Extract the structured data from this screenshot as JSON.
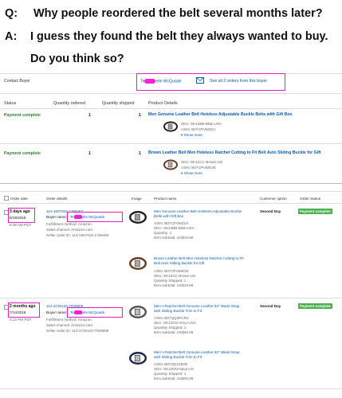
{
  "qa": {
    "q_label": "Q:",
    "q_text": "Why people reordered the belt several months later?",
    "a_label": "A:",
    "a_line1": "I guess they found the belt they always wanted to buy.",
    "a_line2": "Do you think so?"
  },
  "contact": {
    "label": "Contact Buyer",
    "buyer_prefix": "Te",
    "buyer_suffix": "elle McQuade",
    "all_orders_link": "See all 2 orders from this buyer"
  },
  "summary": {
    "headers": [
      "Status",
      "Quantity ordered",
      "Quantity shipped",
      "Product Details"
    ],
    "rows": [
      {
        "status": "Payment complete",
        "qty_ordered": "1",
        "qty_shipped": "1",
        "title": "Men Genuine Leather Belt Holeless Adjustable Buckle Belts with Gift Box",
        "sku": "SKU: SK12BB-Blak-USA",
        "asin": "ASIN: B07CPVMZ1H",
        "more": "Show more"
      },
      {
        "status": "Payment complete",
        "qty_ordered": "1",
        "qty_shipped": "1",
        "title": "Brown Leather Belt Men Holeless Ratchet Cutting to Fit Belt Auto Sliding Buckle for Gift",
        "sku": "SKU: SK12CC-Brown-US",
        "asin": "ASIN: B07CPV58CM",
        "more": "Show more"
      }
    ]
  },
  "orders": {
    "headers": [
      "Order date",
      "Order details",
      "Image",
      "Product name",
      "Customer option",
      "Order Status"
    ],
    "list": [
      {
        "ago": "3 days ago",
        "date": "9/19/2018",
        "time": "9:39 AM PDT",
        "order_id": "114-1607915-1759463",
        "buyer_label": "Buyer name:",
        "buyer_prefix": "Te",
        "buyer_suffix": "elle McQuade",
        "fulfillment": "Fulfillment method: Amazon",
        "channel": "Sales channel: Amazon.com",
        "seller_order": "Seller order ID: 114-1607915-1759463",
        "customer_option": "Second Day",
        "status": "Payment complete",
        "items": [
          {
            "name": "Men Genuine Leather Belt Holeless Adjustable Buckle Belts with Gift Box",
            "asin": "ASIN: B07CPVMZ1H",
            "sku": "SKU: SK12BB-Blak-USA",
            "qty": "Quantity: 1",
            "subtotal": "Item subtotal: US$19.99"
          },
          {
            "name": "Brown Leather Belt Men Holeless Ratchet Cutting to Fit Belt Auto Sliding Buckle for Gift",
            "asin": "ASIN: B07CPV58CM",
            "sku": "SKU: SK12CC-Brown-US",
            "qty": "Quantity Shipped: 1",
            "subtotal": "Item subtotal: US$19.99"
          }
        ]
      },
      {
        "ago": "2 months ago",
        "date": "7/14/2018",
        "time": "3:12 PM PDT",
        "order_id": "114-3730140-7925809",
        "buyer_label": "Buyer name:",
        "buyer_prefix": "Te",
        "buyer_suffix": "elle McQuade",
        "fulfillment": "Fulfillment method: Amazon",
        "channel": "Sales channel: Amazon.com",
        "seller_order": "Seller order ID: 114-3730140-7925809",
        "customer_option": "Second Day",
        "status": "Payment complete",
        "items": [
          {
            "name": "Men`s Ratchet Belt Genuine Leather 53\" Waist Strap with Sliding Buckle Trim to Fit",
            "asin": "ASIN: B07QQ2RCR2",
            "sku": "SKU: SK12GG-Grey-USA",
            "qty": "Quantity Shipped: 1",
            "subtotal": "Item subtotal: US$25.99"
          },
          {
            "name": "Men`s Ratchet Belt Genuine Leather 53\" Waist Strap with Sliding Buckle Trim to Fit",
            "asin": "ASIN: B07QQ1352B",
            "sku": "SKU: SK12NN-Navy-US",
            "qty": "Quantity Shipped: 1",
            "subtotal": "Item subtotal: US$25.99"
          }
        ]
      }
    ]
  },
  "colors": {
    "highlight": "#e020c8",
    "redact": "#ff1fd6",
    "status_green": "#4caf50",
    "link": "#0a5cb0"
  },
  "icons": {
    "belt": "belt-product-icon",
    "envelope": "envelope-icon",
    "more": "chevron-icon"
  }
}
